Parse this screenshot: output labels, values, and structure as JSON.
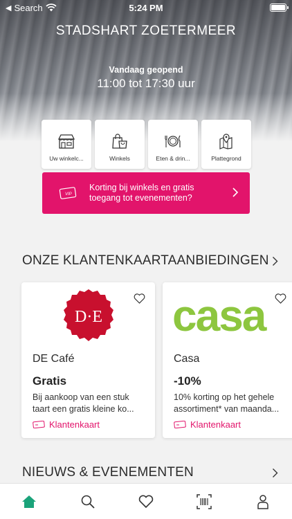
{
  "status_bar": {
    "carrier": "Search",
    "time": "5:24 PM"
  },
  "hero": {
    "title": "STADSHART ZOETERMEER",
    "open_label": "Vandaag geopend",
    "hours": "11:00 tot 17:30 uur"
  },
  "tiles": [
    {
      "label": "Uw winkelc...",
      "icon": "shop-icon"
    },
    {
      "label": "Winkels",
      "icon": "shopping-bag-icon"
    },
    {
      "label": "Eten & drin...",
      "icon": "plate-cutlery-icon"
    },
    {
      "label": "Plattegrond",
      "icon": "map-pin-icon"
    }
  ],
  "vip_banner": {
    "badge": "VIP",
    "text": "Korting bij winkels en gratis toegang tot evenementen?"
  },
  "offers_section": {
    "title": "ONZE KLANTENKAARTAANBIEDINGEN"
  },
  "offers": [
    {
      "logo_text": "D·E",
      "name": "DE Café",
      "deal": "Gratis",
      "description": "Bij aankoop van een stuk taart een gratis kleine ko...",
      "tag": "Klantenkaart"
    },
    {
      "logo_text": "casa",
      "name": "Casa",
      "deal": "-10%",
      "description": "10% korting op het gehele assortiment* van maanda...",
      "tag": "Klantenkaart"
    }
  ],
  "news_section": {
    "title": "NIEUWS & EVENEMENTEN"
  },
  "tabbar": [
    {
      "name": "home",
      "icon": "home-icon",
      "active": true
    },
    {
      "name": "search",
      "icon": "search-icon",
      "active": false
    },
    {
      "name": "favorites",
      "icon": "heart-icon",
      "active": false
    },
    {
      "name": "scan",
      "icon": "barcode-scan-icon",
      "active": false
    },
    {
      "name": "profile",
      "icon": "person-icon",
      "active": false
    }
  ],
  "colors": {
    "accent": "#e2146b",
    "active_tab": "#1aa37a",
    "de_red": "#c8102e",
    "casa_green": "#8dc63f"
  }
}
